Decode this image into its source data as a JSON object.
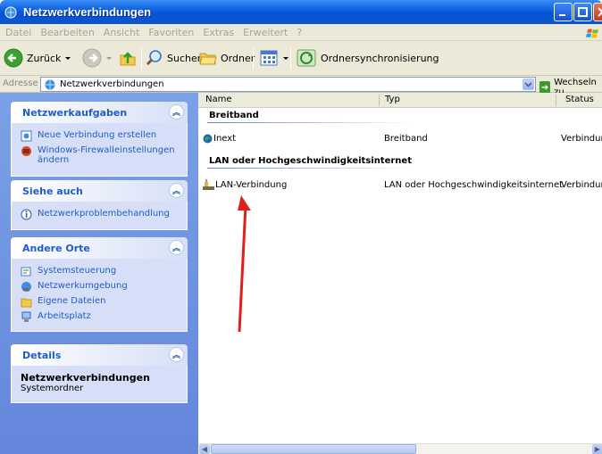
{
  "window": {
    "title": "Netzwerkverbindungen"
  },
  "menu": [
    "Datei",
    "Bearbeiten",
    "Ansicht",
    "Favoriten",
    "Extras",
    "Erweitert",
    "?"
  ],
  "toolbar": {
    "back": "Zurück",
    "search": "Suchen",
    "folders": "Ordner",
    "sync": "Ordnersynchronisierung"
  },
  "address": {
    "label": "Adresse",
    "value": "Netzwerkverbindungen",
    "go": "Wechseln zu"
  },
  "taskpane": {
    "network_tasks": {
      "title": "Netzwerkaufgaben",
      "items": [
        "Neue Verbindung erstellen",
        "Windows-Firewalleinstellungen ändern"
      ]
    },
    "see_also": {
      "title": "Siehe auch",
      "items": [
        "Netzwerkproblembehandlung"
      ]
    },
    "other_places": {
      "title": "Andere Orte",
      "items": [
        "Systemsteuerung",
        "Netzwerkumgebung",
        "Eigene Dateien",
        "Arbeitsplatz"
      ]
    },
    "details": {
      "title": "Details",
      "name": "Netzwerkverbindungen",
      "type": "Systemordner"
    }
  },
  "list": {
    "columns": [
      "Name",
      "Typ",
      "Status"
    ],
    "groups": [
      {
        "title": "Breitband",
        "rows": [
          {
            "name": "Inext",
            "type": "Breitband",
            "status": "Verbindung"
          }
        ]
      },
      {
        "title": "LAN oder Hochgeschwindigkeitsinternet",
        "rows": [
          {
            "name": "LAN-Verbindung",
            "type": "LAN oder Hochgeschwindigkeitsinternet",
            "status": "Verbindung"
          }
        ]
      }
    ]
  },
  "colors": {
    "title_bar": "#0a5fde",
    "task_link": "#215dc6",
    "annotation_arrow": "#e0201c"
  }
}
